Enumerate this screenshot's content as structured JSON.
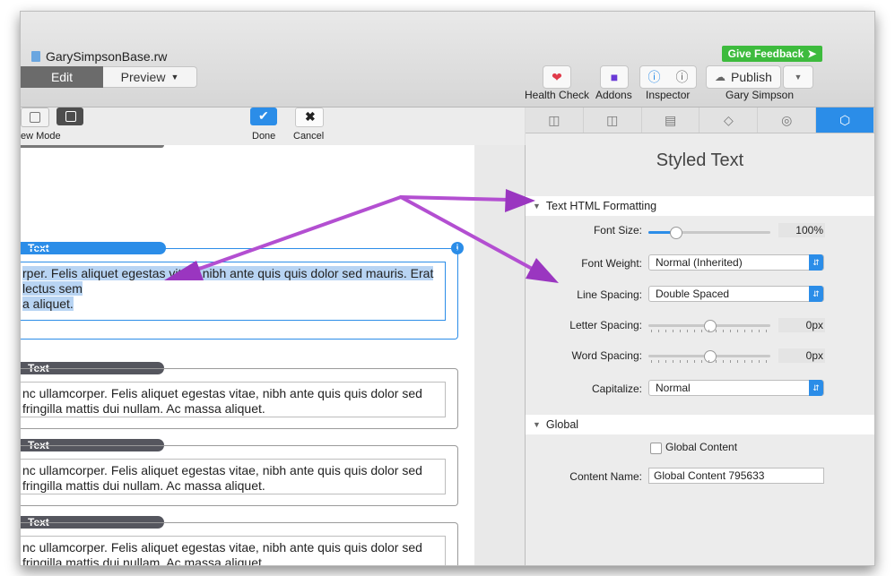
{
  "window": {
    "title": "GarySimpsonBase.rw",
    "feedback_label": "Give Feedback"
  },
  "mode_tabs": {
    "edit": "Edit",
    "preview": "Preview"
  },
  "toolbar": {
    "health_label": "Health Check",
    "addons_label": "Addons",
    "inspector_label": "Inspector",
    "publish_label": "Publish",
    "user_label": "Gary Simpson"
  },
  "editbar": {
    "view_mode_label": "ew Mode",
    "done_label": "Done",
    "cancel_label": "Cancel"
  },
  "canvas": {
    "blocks": [
      {
        "tag": "Text",
        "line1": "rper. Felis aliquet egestas vitae, nibh ante quis quis dolor sed mauris. Erat lectus sem",
        "line2": "a aliquet."
      },
      {
        "tag": "Text",
        "line1": "nc ullamcorper. Felis aliquet egestas vitae, nibh ante quis quis dolor sed",
        "line2": "fringilla mattis dui nullam. Ac massa aliquet."
      },
      {
        "tag": "Text",
        "line1": "nc ullamcorper. Felis aliquet egestas vitae, nibh ante quis quis dolor sed",
        "line2": "fringilla mattis dui nullam. Ac massa aliquet."
      },
      {
        "tag": "Text",
        "line1": "nc ullamcorper. Felis aliquet egestas vitae, nibh ante quis quis dolor sed",
        "line2": "fringilla mattis dui nullam. Ac massa aliquet."
      }
    ]
  },
  "inspector": {
    "title": "Styled Text",
    "section_formatting": "Text HTML Formatting",
    "font_size": {
      "label": "Font Size:",
      "value": "100%",
      "level": 0.22
    },
    "font_weight": {
      "label": "Font Weight:",
      "value": "Normal (Inherited)"
    },
    "line_spacing": {
      "label": "Line Spacing:",
      "value": "Double Spaced"
    },
    "letter_spacing": {
      "label": "Letter Spacing:",
      "value": "0px",
      "level": 0.5
    },
    "word_spacing": {
      "label": "Word Spacing:",
      "value": "0px",
      "level": 0.5
    },
    "capitalize": {
      "label": "Capitalize:",
      "value": "Normal"
    },
    "section_global": "Global",
    "global_content": {
      "label": "Global Content",
      "checked": false
    },
    "content_name": {
      "label": "Content Name:",
      "value": "Global Content 795633"
    }
  },
  "colors": {
    "accent": "#2b8de8",
    "arrow": "#a73fc2",
    "feedback": "#3dbb3d"
  }
}
